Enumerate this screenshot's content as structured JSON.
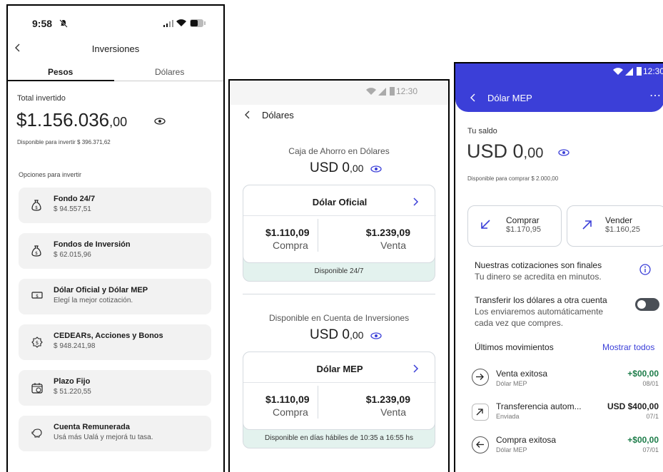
{
  "screen1": {
    "status_time": "9:58",
    "title": "Inversiones",
    "tabs": [
      "Pesos",
      "Dólares"
    ],
    "total_label": "Total invertido",
    "total_main": "$1.156.036",
    "total_cents": ",00",
    "available": "Disponible para invertir $ 396.371,62",
    "options_label": "Opciones para invertir",
    "options": [
      {
        "title": "Fondo 24/7",
        "value": "$ 94.557,51",
        "icon": "money-bag-icon"
      },
      {
        "title": "Fondos de Inversión",
        "value": "$ 62.015,96",
        "icon": "money-bag-icon"
      },
      {
        "title": "Dólar Oficial y Dólar MEP",
        "value": "Elegí la mejor cotización.",
        "icon": "banknote-icon"
      },
      {
        "title": "CEDEARs, Acciones y Bonos",
        "value": "$ 948.241,98",
        "icon": "coin-icon"
      },
      {
        "title": "Plazo Fijo",
        "value": "$ 51.220,55",
        "icon": "calendar-money-icon"
      },
      {
        "title": "Cuenta Remunerada",
        "value": "Usá más Ualá y mejorá tu tasa.",
        "icon": "piggy-bank-icon"
      }
    ]
  },
  "screen2": {
    "status_time": "12:30",
    "title": "Dólares",
    "section1": {
      "label": "Caja de Ahorro en Dólares",
      "amount": "USD 0",
      "cents": ",00"
    },
    "card1": {
      "title": "Dólar Oficial",
      "buy_value": "$1.110,09",
      "buy_label": "Compra",
      "sell_value": "$1.239,09",
      "sell_label": "Venta",
      "footer": "Disponible 24/7"
    },
    "section2": {
      "label": "Disponible en Cuenta de Inversiones",
      "amount": "USD 0",
      "cents": ",00"
    },
    "card2": {
      "title": "Dólar MEP",
      "buy_value": "$1.110,09",
      "buy_label": "Compra",
      "sell_value": "$1.239,09",
      "sell_label": "Venta",
      "footer": "Disponible en días hábiles de 10:35 a 16:55 hs"
    }
  },
  "screen3": {
    "status_time": "12:30",
    "title": "Dólar MEP",
    "saldo_label": "Tu saldo",
    "amount": "USD 0",
    "cents": ",00",
    "available": "Disponible para comprar $ 2.000,00",
    "buy": {
      "label": "Comprar",
      "value": "$1.170,95"
    },
    "sell": {
      "label": "Vender",
      "value": "$1.160,25"
    },
    "info_title": "Nuestras cotizaciones son finales",
    "info_sub": "Tu dinero se acredita en minutos.",
    "transfer_title": "Transferir los dólares a otra cuenta",
    "transfer_sub1": "Los enviaremos automáticamente",
    "transfer_sub2": "cada vez que compres.",
    "movements_label": "Últimos movimientos",
    "show_all": "Mostrar todos",
    "movements": [
      {
        "title": "Venta exitosa",
        "sub": "Dólar MEP",
        "amount": "+$00,00",
        "date": "08/01",
        "icon": "arrow-right-icon"
      },
      {
        "title": "Transferencia autom...",
        "sub": "Enviada",
        "amount": "USD $400,00",
        "date": "07/1",
        "icon": "arrow-up-right-icon"
      },
      {
        "title": "Compra exitosa",
        "sub": "Dólar MEP",
        "amount": "+$00,00",
        "date": "07/01",
        "icon": "arrow-left-icon"
      }
    ]
  },
  "colors": {
    "accent_blue": "#3b3fd8",
    "green": "#1e7d4a",
    "teal_bg": "#e3f2ee"
  }
}
